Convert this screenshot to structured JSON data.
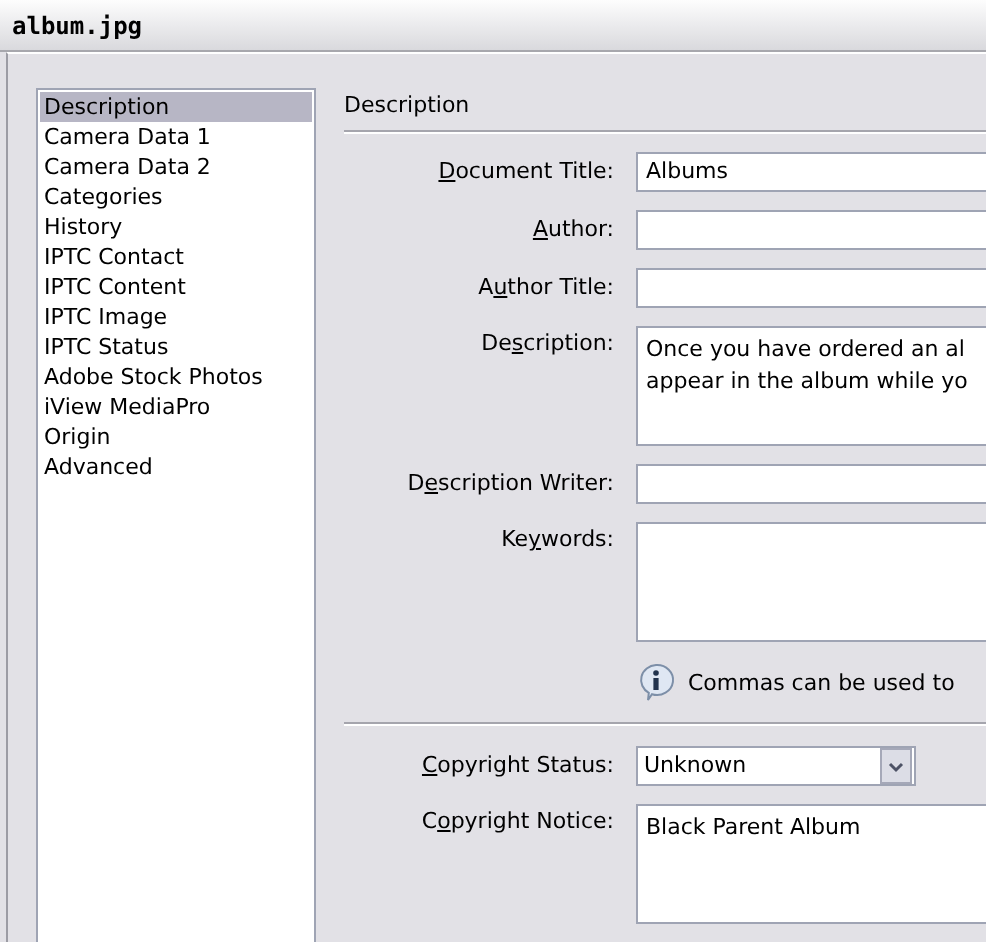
{
  "window": {
    "title": "album.jpg"
  },
  "sidebar": {
    "items": [
      {
        "label": "Description",
        "selected": true
      },
      {
        "label": "Camera Data 1",
        "selected": false
      },
      {
        "label": "Camera Data 2",
        "selected": false
      },
      {
        "label": "Categories",
        "selected": false
      },
      {
        "label": "History",
        "selected": false
      },
      {
        "label": "IPTC Contact",
        "selected": false
      },
      {
        "label": "IPTC Content",
        "selected": false
      },
      {
        "label": "IPTC Image",
        "selected": false
      },
      {
        "label": "IPTC Status",
        "selected": false
      },
      {
        "label": "Adobe Stock Photos",
        "selected": false
      },
      {
        "label": "iView MediaPro",
        "selected": false
      },
      {
        "label": "Origin",
        "selected": false
      },
      {
        "label": "Advanced",
        "selected": false
      }
    ]
  },
  "panel": {
    "heading": "Description",
    "fields": [
      {
        "kind": "text",
        "label": {
          "accel": "D",
          "after": "ocument Title:"
        },
        "value": "Albums"
      },
      {
        "kind": "text",
        "label": {
          "accel": "A",
          "after": "uthor:"
        }
      },
      {
        "kind": "text",
        "label": {
          "before": "A",
          "accel": "u",
          "after": "thor Title:"
        }
      },
      {
        "kind": "area",
        "label": {
          "before": "De",
          "accel": "s",
          "after": "cription:"
        },
        "lines": [
          "Once you have ordered an al",
          "appear in the album while yo"
        ]
      },
      {
        "kind": "text",
        "label": {
          "before": "D",
          "accel": "e",
          "after": "scription Writer:"
        }
      },
      {
        "kind": "area",
        "label": {
          "before": "Ke",
          "accel": "y",
          "after": "words:"
        }
      },
      {
        "kind": "note",
        "text": "Commas can be used to"
      },
      {
        "kind": "rule"
      },
      {
        "kind": "select",
        "label": {
          "accel": "C",
          "after": "opyright Status:"
        },
        "value": "Unknown"
      },
      {
        "kind": "area",
        "label": {
          "before": "C",
          "accel": "o",
          "after": "pyright Notice:"
        },
        "lines": [
          "Black Parent Album"
        ]
      }
    ]
  }
}
